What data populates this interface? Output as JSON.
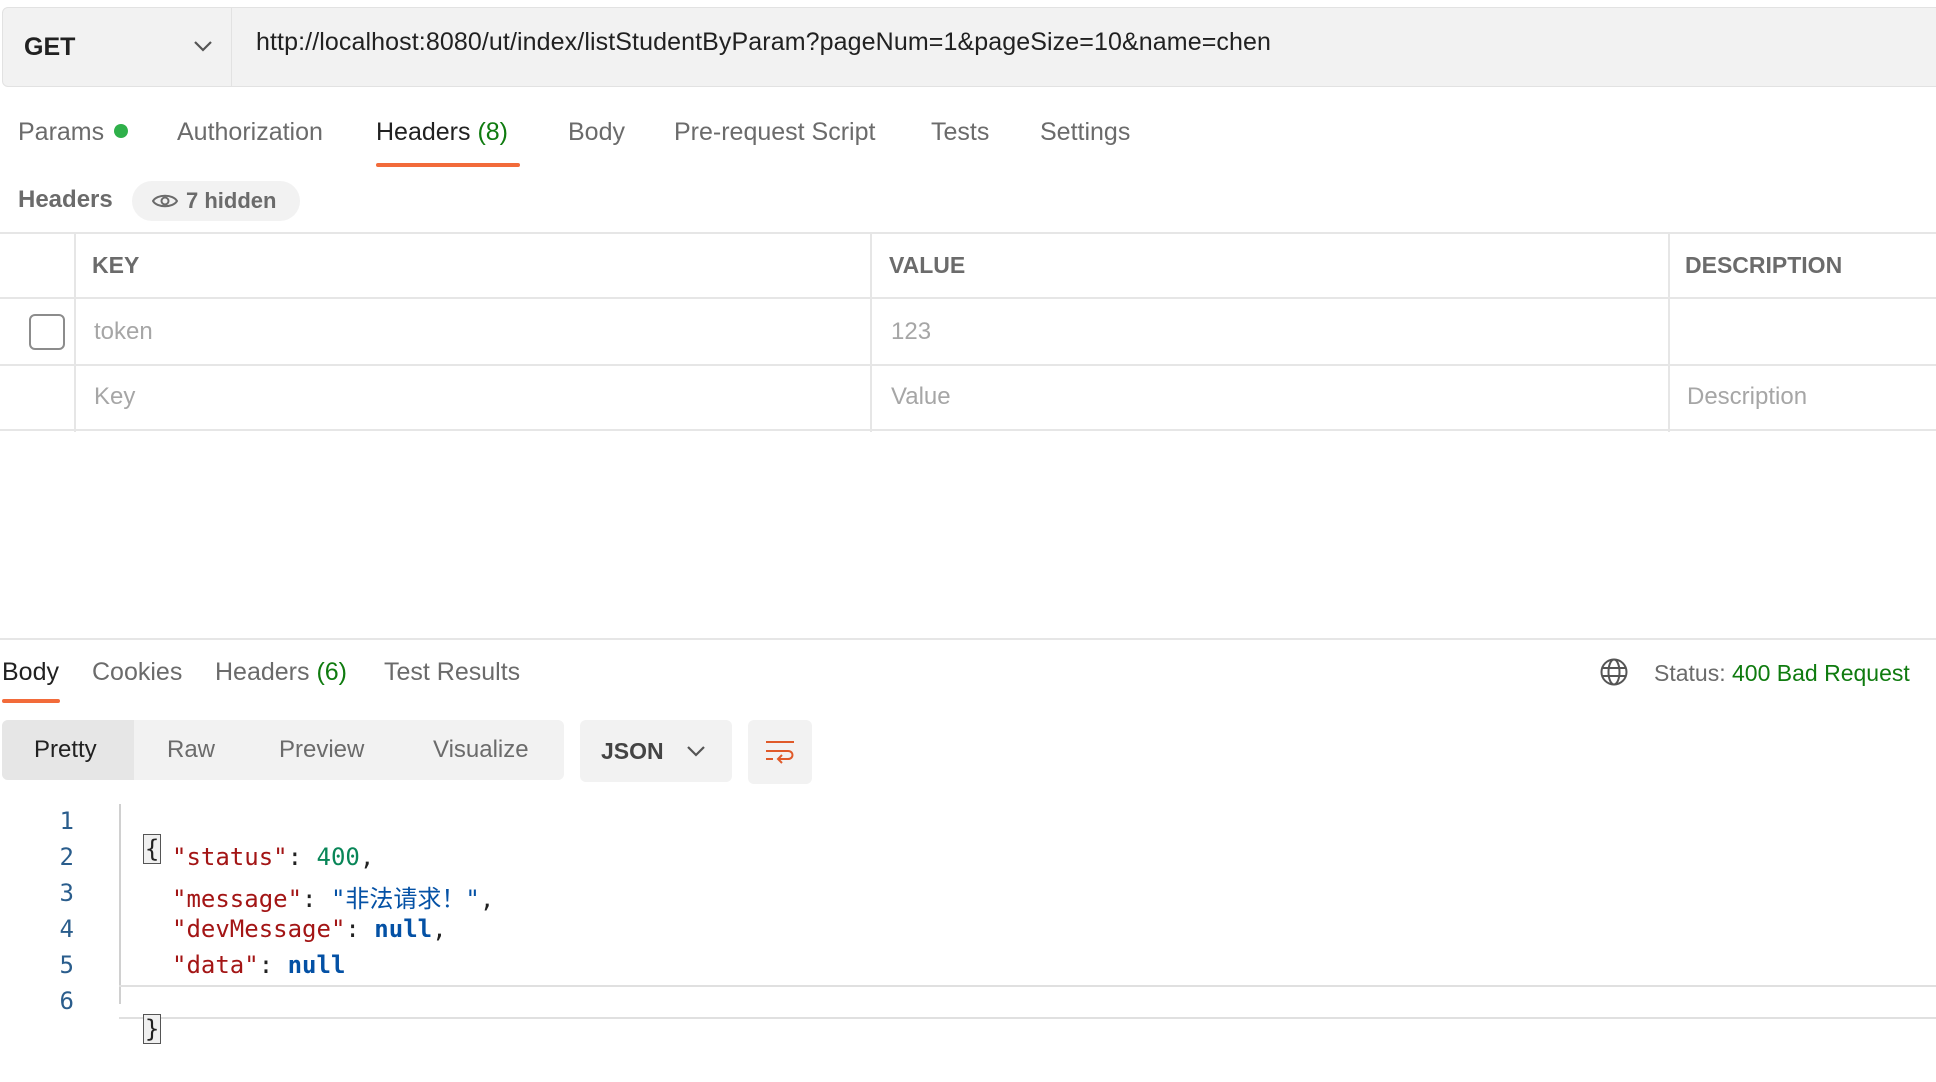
{
  "request": {
    "method": "GET",
    "url": "http://localhost:8080/ut/index/listStudentByParam?pageNum=1&pageSize=10&name=chen"
  },
  "request_tabs": {
    "params": "Params",
    "authorization": "Authorization",
    "headers": "Headers",
    "headers_count": "(8)",
    "body": "Body",
    "pre_request": "Pre-request Script",
    "tests": "Tests",
    "settings": "Settings"
  },
  "headers_section": {
    "title": "Headers",
    "hidden": "7 hidden",
    "columns": {
      "key": "KEY",
      "value": "VALUE",
      "description": "DESCRIPTION"
    },
    "rows": [
      {
        "key": "token",
        "value": "123",
        "description": "",
        "enabled": false
      }
    ],
    "placeholders": {
      "key": "Key",
      "value": "Value",
      "description": "Description"
    }
  },
  "response_tabs": {
    "body": "Body",
    "cookies": "Cookies",
    "headers": "Headers",
    "headers_count": "(6)",
    "test_results": "Test Results"
  },
  "status": {
    "label": "Status:",
    "code": "400",
    "text": "Bad Request"
  },
  "view_modes": {
    "pretty": "Pretty",
    "raw": "Raw",
    "preview": "Preview",
    "visualize": "Visualize",
    "format": "JSON"
  },
  "code": {
    "line_numbers": [
      "1",
      "2",
      "3",
      "4",
      "5",
      "6"
    ],
    "open_brace": "{",
    "close_brace": "}",
    "k_status": "\"status\"",
    "v_status": "400",
    "k_message": "\"message\"",
    "v_message": "\"非法请求！\"",
    "k_devMessage": "\"devMessage\"",
    "v_devMessage": "null",
    "k_data": "\"data\"",
    "v_data": "null"
  },
  "colors": {
    "accent": "#f26b3a",
    "status_green": "#0f7b0f",
    "dot_green": "#2fb04a"
  },
  "icons": [
    "chevron-down-icon",
    "eye-icon",
    "globe-icon",
    "wrap-lines-icon"
  ]
}
